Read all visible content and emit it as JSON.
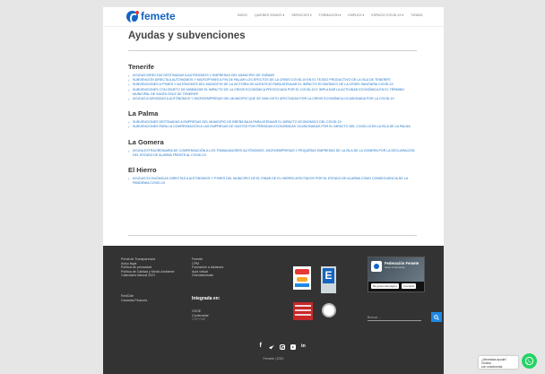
{
  "header": {
    "logo_text": "femete",
    "nav": [
      "INICIO",
      "QUIENES SOMOS ▾",
      "SERVICIOS ▾",
      "FORMACIÓN ▾",
      "EMPLEO ▾",
      "ESPACIO COVID-19 ▾",
      "TIENDA"
    ]
  },
  "main": {
    "title": "Ayudas y subvenciones",
    "sections": [
      {
        "title": "Tenerife",
        "links": [
          "AYUDAS DIRECTAS DESTINADAS A AUTÓNOMOS Y EMPRESAS DEL MUNICIPIO DE GÜÍMAR",
          "SUBVENCIÓN DIRECTA A AUTÓNOMOS Y MICROPYMES A FIN DE PALIAR LOS EFECTOS DE LA CRISIS COVID-19 EN EL TEJIDO PRODUCTIVO DE LA ISLA DE TENERIFE",
          "SUBVENCIONES A PYMES Y AUTÓNOMOS DEL MUNICIPIO DE LA VICTORIA DE ACENTEJO PARA ATENUAR EL IMPACTO ECONÓMICO DE LA CRISIS SANITARIA COVID-19",
          "SUBVENCIONES CON OBJETO DE MINIMIZAR EL IMPACTO DE LA CRISIS ECONÓMICA PROVOCADA POR EL COVID-19 E IMPULSAR LA ACTIVIDAD ECONÓMICA EN EL TÉRMINO MUNICIPAL DE SANTA CRUZ DE TENERIFE",
          "AYUDAS A DIRIGIDAS A AUTÓNOMOS Y MICROEMPRESAS DEL MUNICIPIO QUE SE HAN VISTO AFECTADAS POR LA CRISIS ECONÓMICA OCASIONADA POR LA COVID-19"
        ]
      },
      {
        "title": "La Palma",
        "links": [
          "SUBVENCIONES DESTINADAS A EMPRESAS DEL MUNICIPIO DE BREÑA BAJA PARA ATENUAR EL IMPACTO ECONÓMICO DEL COVID-19",
          "SUBVENCIONES PARA LA COMPENSACIÓN A LAS EMPRESAS DE GASTOS POR PÉRDIDAS ECONÓMICAS OCASIONADAS POR EL IMPACTO DEL COVID-19 EN LA ISLA DE LA PALMA"
        ]
      },
      {
        "title": "La Gomera",
        "links": [
          "AYUDA EXTRAORDINARIA DE COMPENSACIÓN A LOS TRABAJADORES AUTÓNOMOS, MICROEMPRESAS Y PEQUEÑAS EMPRESAS DE LA ISLA DE LA GOMERA POR LA DECLARACIÓN DEL ESTADO DE ALARMA FRENTE AL COVID-19"
        ]
      },
      {
        "title": "El Hierro",
        "links": [
          "AYUDAS ECONÓMICAS DIRECTAS A AUTÓNOMOS Y PYMES DEL MUNICIPIO DE EL PINAR DE EL HIERRO AFECTADOS POR EL ESTADO DE ALARMA COMO CONSECUENCIA DE LA PANDEMIA COVID-19"
        ]
      }
    ]
  },
  "footer": {
    "col1": [
      "Portal de Transparencia",
      "Aviso legal",
      "Política de privacidad",
      "Política de Calidad y Medio Ambiente",
      "Calendario laboral 2021"
    ],
    "col1b": [
      "RedCide",
      "Canarias Financia"
    ],
    "col2": [
      "Femete",
      "CPM",
      "Formación a distancia",
      "Aula virtual",
      "Orientaformate"
    ],
    "integrada_title": "Integrada en:",
    "col2b": [
      "CEOE",
      "Confemetal",
      "CEPYME"
    ],
    "facebook": {
      "name": "Federación Femete",
      "sub": "Hace 2 semanas",
      "like": "Me gusta esta página",
      "share": "Compartir"
    },
    "search_placeholder": "Buscar ...",
    "copyright": "Femete | 2021"
  },
  "chat": {
    "line1": "¿Necesitas ayuda? Chatea",
    "line2": "con nosotros/as"
  },
  "colors": {
    "brand_blue": "#1565c0",
    "link_blue": "#1a73c9",
    "footer_bg": "#333333",
    "whatsapp": "#25d366"
  }
}
